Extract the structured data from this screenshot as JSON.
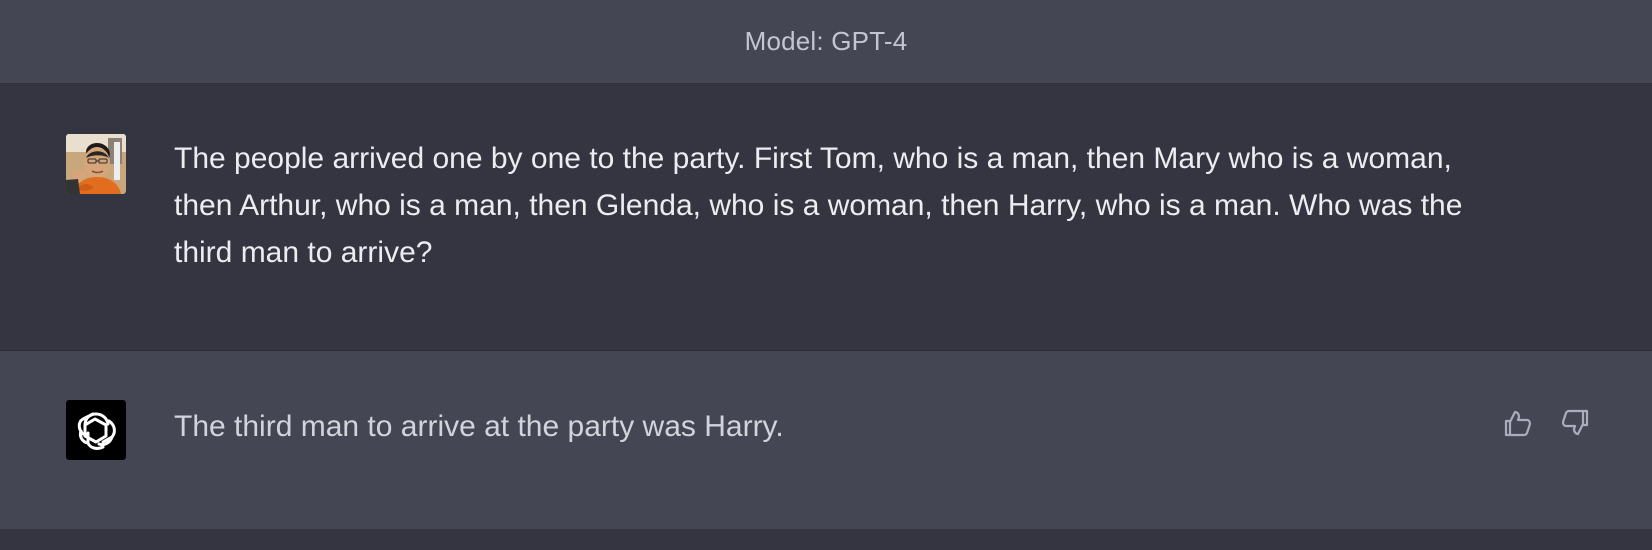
{
  "header": {
    "model_label": "Model: GPT-4"
  },
  "conversation": {
    "user_message": {
      "avatar_icon": "user-avatar-photo",
      "text": "The people arrived one by one to the party.  First Tom, who is a man, then Mary who is a woman, then Arthur, who is a man, then Glenda, who is a woman, then Harry, who is a man.  Who was the third man to arrive?"
    },
    "assistant_message": {
      "avatar_icon": "openai-logo-icon",
      "text": "The third man to arrive at the party was Harry.",
      "actions": {
        "thumbs_up_icon": "thumbs-up-icon",
        "thumbs_down_icon": "thumbs-down-icon"
      }
    }
  },
  "colors": {
    "background": "#343541",
    "assistant_background": "#444654",
    "text": "#ececf1",
    "assistant_text": "#d1d5db",
    "muted_text": "#c5c5d2"
  }
}
